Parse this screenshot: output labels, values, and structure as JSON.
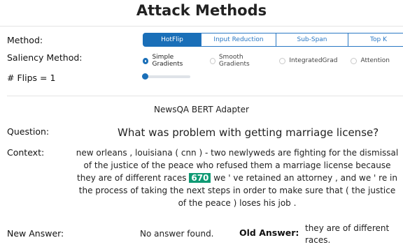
{
  "header": {
    "title": "Attack Methods"
  },
  "controls": {
    "method_label": "Method:",
    "method_tabs": [
      {
        "label": "HotFlip",
        "active": true
      },
      {
        "label": "Input Reduction",
        "active": false
      },
      {
        "label": "Sub-Span",
        "active": false
      },
      {
        "label": "Top K",
        "active": false
      }
    ],
    "saliency_label": "Saliency Method:",
    "saliency_options": [
      {
        "label": "Simple Gradients",
        "checked": true
      },
      {
        "label": "Smooth Gradients",
        "checked": false
      },
      {
        "label": "IntegratedGrad",
        "checked": false
      },
      {
        "label": "Attention",
        "checked": false
      }
    ],
    "flips_label": "# Flips = 1",
    "flips_value": 1
  },
  "result": {
    "model_name": "NewsQA BERT Adapter",
    "question_label": "Question:",
    "question": "What was problem with getting marriage license?",
    "context_label": "Context:",
    "context_before": "new orleans , louisiana ( cnn ) - two newlyweds are fighting for the dismissal of the justice of the peace who refused them a marriage license because they are of different races ",
    "flipped_token": "670",
    "context_after": " we ' ve retained an attorney , and we ' re in the process of taking the next steps in order to make sure that ( the justice of the peace ) loses his job .",
    "new_answer_label": "New Answer:",
    "new_answer": "No answer found.",
    "old_answer_label": "Old Answer:",
    "old_answer": "they are of different races."
  },
  "colors": {
    "accent": "#1a6fb8",
    "flip_highlight": "#0f9a74"
  }
}
